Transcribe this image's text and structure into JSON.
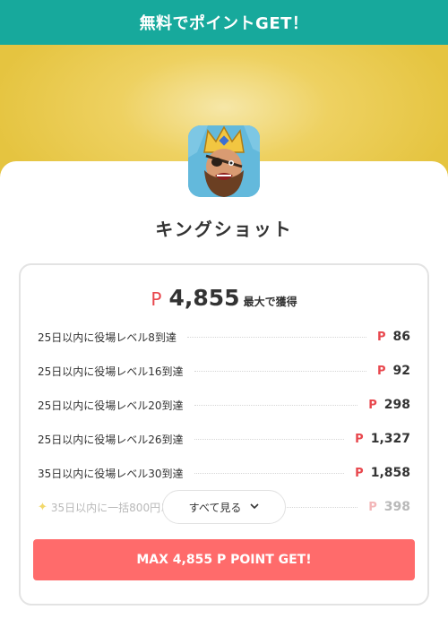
{
  "header": {
    "title": "無料でポイントGET！"
  },
  "app": {
    "name": "キングショット",
    "icon": "king-warrior-app-icon"
  },
  "reward": {
    "point_symbol": "P",
    "total": "4,855",
    "total_suffix": "最大で獲得"
  },
  "tasks": [
    {
      "label": "25日以内に役場レベル8到達",
      "points": "86"
    },
    {
      "label": "25日以内に役場レベル16到達",
      "points": "92"
    },
    {
      "label": "25日以内に役場レベル20到達",
      "points": "298"
    },
    {
      "label": "25日以内に役場レベル26到達",
      "points": "1,327"
    },
    {
      "label": "35日以内に役場レベル30到達",
      "points": "1,858"
    },
    {
      "label": "35日以内に一括800円以",
      "points": "398",
      "icon": "sparkle-icon"
    }
  ],
  "see_all": {
    "label": "すべて見る",
    "icon": "chevron-down-icon"
  },
  "cta": {
    "label": "MAX 4,855 P POINT GET!"
  },
  "colors": {
    "header": "#17a99c",
    "accent_red": "#e8474d",
    "cta": "#ff6b6b",
    "hero_gold": "#e5c440"
  }
}
